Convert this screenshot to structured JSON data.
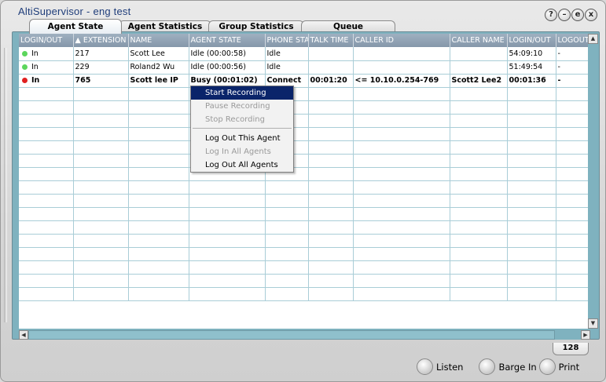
{
  "window": {
    "app": "AltiSupervisor",
    "separator": "-",
    "user": "eng  test"
  },
  "window_buttons": [
    "?",
    "–",
    "e",
    "x"
  ],
  "tabs": [
    "Agent State",
    "Agent Statistics",
    "Group Statistics",
    "Queue"
  ],
  "table": {
    "columns": [
      "LOGIN/OUT",
      "▲ EXTENSION",
      "NAME",
      "AGENT STATE",
      "PHONE STAT",
      "TALK TIME",
      "CALLER ID",
      "CALLER NAME",
      "LOGIN/OUT",
      "LOGOUT"
    ],
    "rows": [
      {
        "status": "In",
        "extension": "217",
        "name": "Scott Lee",
        "agent_state": "Idle (00:00:58)",
        "phone_state": "Idle",
        "talk_time": "",
        "caller_id": "",
        "caller_name": "",
        "login_time": "54:09:10",
        "logout": "-",
        "dot_color": "#5cd65c",
        "bold": false
      },
      {
        "status": "In",
        "extension": "229",
        "name": "Roland2 Wu",
        "agent_state": "Idle (00:00:56)",
        "phone_state": "Idle",
        "talk_time": "",
        "caller_id": "",
        "caller_name": "",
        "login_time": "51:49:54",
        "logout": "-",
        "dot_color": "#5cd65c",
        "bold": false
      },
      {
        "status": "In",
        "extension": "765",
        "name": "Scott lee IP",
        "agent_state": "Busy (00:01:02)",
        "phone_state": "Connect",
        "talk_time": "00:01:20",
        "caller_id": "<= 10.10.0.254-769",
        "caller_name": "Scott2 Lee2",
        "login_time": "00:01:36",
        "logout": "-",
        "dot_color": "#e02020",
        "bold": true
      }
    ],
    "empty_rows": 16
  },
  "context_menu": {
    "items": [
      {
        "label": "Start Recording",
        "state": "selected"
      },
      {
        "label": "Pause Recording",
        "state": "disabled"
      },
      {
        "label": "Stop Recording",
        "state": "disabled"
      },
      {
        "label": "Log Out This Agent",
        "state": "enabled"
      },
      {
        "label": "Log In All Agents",
        "state": "disabled"
      },
      {
        "label": "Log Out All Agents",
        "state": "enabled"
      }
    ]
  },
  "agent_count": "128",
  "footer_buttons": [
    "Listen",
    "Barge In",
    "Print"
  ],
  "colors": {
    "grid_accent": "#7fb2bf",
    "header": "#8a9cb0",
    "menu_selected": "#0a246a"
  }
}
